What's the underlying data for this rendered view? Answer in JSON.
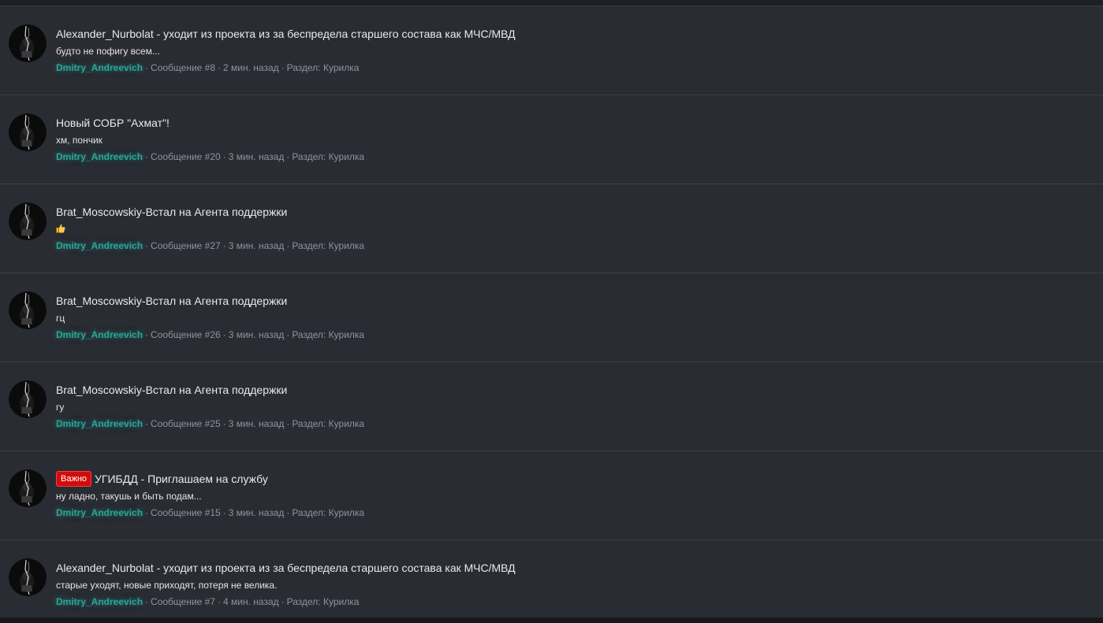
{
  "colors": {
    "page_bg": "#1c1d21",
    "feed_bg": "#2a2c33",
    "divider": "#3d4048",
    "author": "#2aa596",
    "meta_text": "#8f939c",
    "badge_bg": "#d20c0c"
  },
  "feed": {
    "items": [
      {
        "title": "Alexander_Nurbolat - уходит из проекта из за беспредела старшего состава как МЧС/МВД",
        "snippet": "будто не пофигу всем...",
        "author": "Dmitry_Andreevich",
        "message": "Сообщение #8",
        "time": "2 мин. назад",
        "section": "Раздел: Курилка"
      },
      {
        "title": "Новый СОБР \"Ахмат\"!",
        "snippet": "хм, пончик",
        "author": "Dmitry_Andreevich",
        "message": "Сообщение #20",
        "time": "3 мин. назад",
        "section": "Раздел: Курилка"
      },
      {
        "title": "Brat_Moscowskiy-Встал на Агента поддержки",
        "snippet_icon": "thumbs-up-icon",
        "author": "Dmitry_Andreevich",
        "message": "Сообщение #27",
        "time": "3 мин. назад",
        "section": "Раздел: Курилка"
      },
      {
        "title": "Brat_Moscowskiy-Встал на Агента поддержки",
        "snippet": "гц",
        "author": "Dmitry_Andreevich",
        "message": "Сообщение #26",
        "time": "3 мин. назад",
        "section": "Раздел: Курилка"
      },
      {
        "title": "Brat_Moscowskiy-Встал на Агента поддержки",
        "snippet": "гу",
        "author": "Dmitry_Andreevich",
        "message": "Сообщение #25",
        "time": "3 мин. назад",
        "section": "Раздел: Курилка"
      },
      {
        "badge": "Важно",
        "title": "УГИБДД - Приглашаем на службу",
        "snippet": "ну ладно, такушь и быть подам...",
        "author": "Dmitry_Andreevich",
        "message": "Сообщение #15",
        "time": "3 мин. назад",
        "section": "Раздел: Курилка"
      },
      {
        "title": "Alexander_Nurbolat - уходит из проекта из за беспредела старшего состава как МЧС/МВД",
        "snippet": "старые уходят, новые приходят, потеря не велика.",
        "author": "Dmitry_Andreevich",
        "message": "Сообщение #7",
        "time": "4 мин. назад",
        "section": "Раздел: Курилка"
      }
    ]
  }
}
